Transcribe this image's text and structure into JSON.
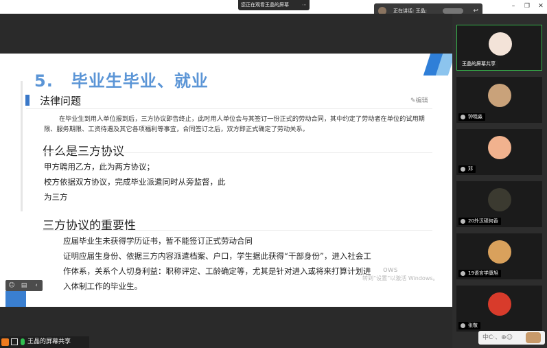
{
  "window": {
    "share_banner": "您正在观看王晶的屏幕",
    "share_banner_action": "⋯",
    "min_label": "–",
    "max_label": "❐",
    "close_label": "✕"
  },
  "speaking": {
    "text": "正在讲话: 王晶;",
    "return_icon": "↩"
  },
  "slide": {
    "number": "5.",
    "title": "毕业生毕业、就业",
    "section_heading": "法律问题",
    "edit_label": "✎编辑",
    "legal_paragraph": "在毕业生到用人单位报到后，三方协议即告终止，此时用人单位会与其签订一份正式的劳动合同，其中约定了劳动者在单位的试用期限、服务期限、工资待遇及其它各项福利等事宜，合同签订之后，双方即正式确定了劳动关系。",
    "what_heading": "什么是三方协议",
    "what_lines": [
      "甲方聘用乙方，此为两方协议；",
      "校方依据双方协议，完成毕业派遣同时从旁监督，此",
      "为三方"
    ],
    "importance_heading": "三方协议的重要性",
    "importance_lines": [
      "应届毕业生未获得学历证书，暂不能签订正式劳动合同",
      "证明应届生身份、依据三方内容派遣档案、户口，学生据此获得“干部身份”，进入社会工",
      "作体系，关系个人切身利益：职称评定、工龄确定等，尤其是针对进入或将来打算计划进",
      "入体制工作的毕业生。"
    ],
    "watermark_title": "ows",
    "watermark_sub": "转到“设置”以激活 Windows。",
    "tools": [
      "☺",
      "▤",
      "‹"
    ]
  },
  "bottom_share": {
    "label": "王晶的屏幕共享"
  },
  "participants": [
    {
      "name": "王晶的屏幕共享",
      "active": true,
      "avatar_color": "#f3e3d8"
    },
    {
      "name": "钟晓淼",
      "active": false,
      "avatar_color": "#c9a27a"
    },
    {
      "name": "邓",
      "active": false,
      "avatar_color": "#f1b28e"
    },
    {
      "name": "20外汉硕何香",
      "active": false,
      "avatar_color": "#3b3a30"
    },
    {
      "name": "19语言学康旭",
      "active": false,
      "avatar_color": "#d9a15c"
    },
    {
      "name": "张敬",
      "active": false,
      "avatar_color": "#d83b2b"
    }
  ],
  "chat": {
    "placeholder": "中C·、⊕☺"
  }
}
